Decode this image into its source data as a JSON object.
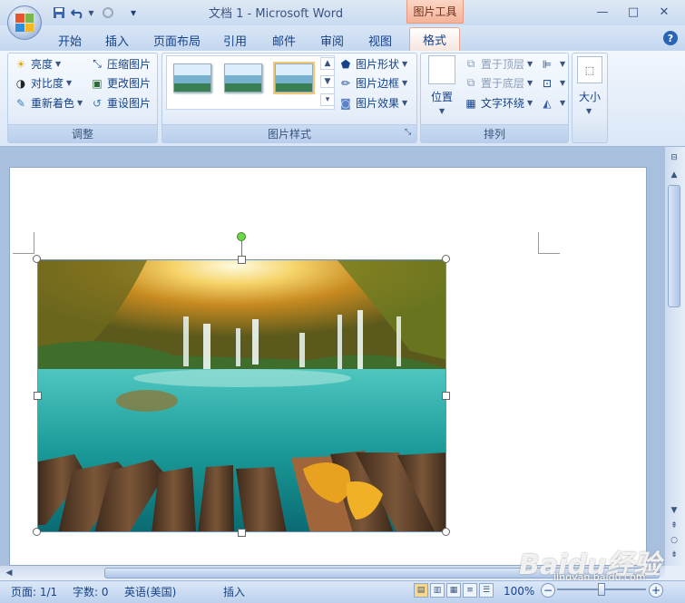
{
  "window": {
    "title": "文档 1 - Microsoft Word",
    "context_tab_group": "图片工具"
  },
  "quick_access": [
    "save-icon",
    "undo-icon",
    "redo-icon",
    "customize-icon"
  ],
  "tabs": [
    "开始",
    "插入",
    "页面布局",
    "引用",
    "邮件",
    "审阅",
    "视图",
    "格式"
  ],
  "active_tab": "格式",
  "ribbon": {
    "adjust": {
      "label": "调整",
      "brightness": "亮度",
      "contrast": "对比度",
      "recolor": "重新着色",
      "compress": "压缩图片",
      "change": "更改图片",
      "reset": "重设图片"
    },
    "styles": {
      "label": "图片样式",
      "shape": "图片形状",
      "border": "图片边框",
      "effect": "图片效果"
    },
    "arrange": {
      "label": "排列",
      "position": "位置",
      "front": "置于顶层",
      "back": "置于底层",
      "wrap": "文字环绕"
    },
    "size": {
      "label": "大小"
    }
  },
  "status": {
    "page": "页面: 1/1",
    "words": "字数: 0",
    "language": "英语(美国)",
    "mode": "插入",
    "zoom": "100%"
  },
  "watermark": {
    "brand": "Baidu经验",
    "url": "jingyan.baidu.com"
  },
  "colors": {
    "accent": "#15428b",
    "context_tab": "#f4b29a",
    "rotate_handle": "#6ed64a"
  }
}
